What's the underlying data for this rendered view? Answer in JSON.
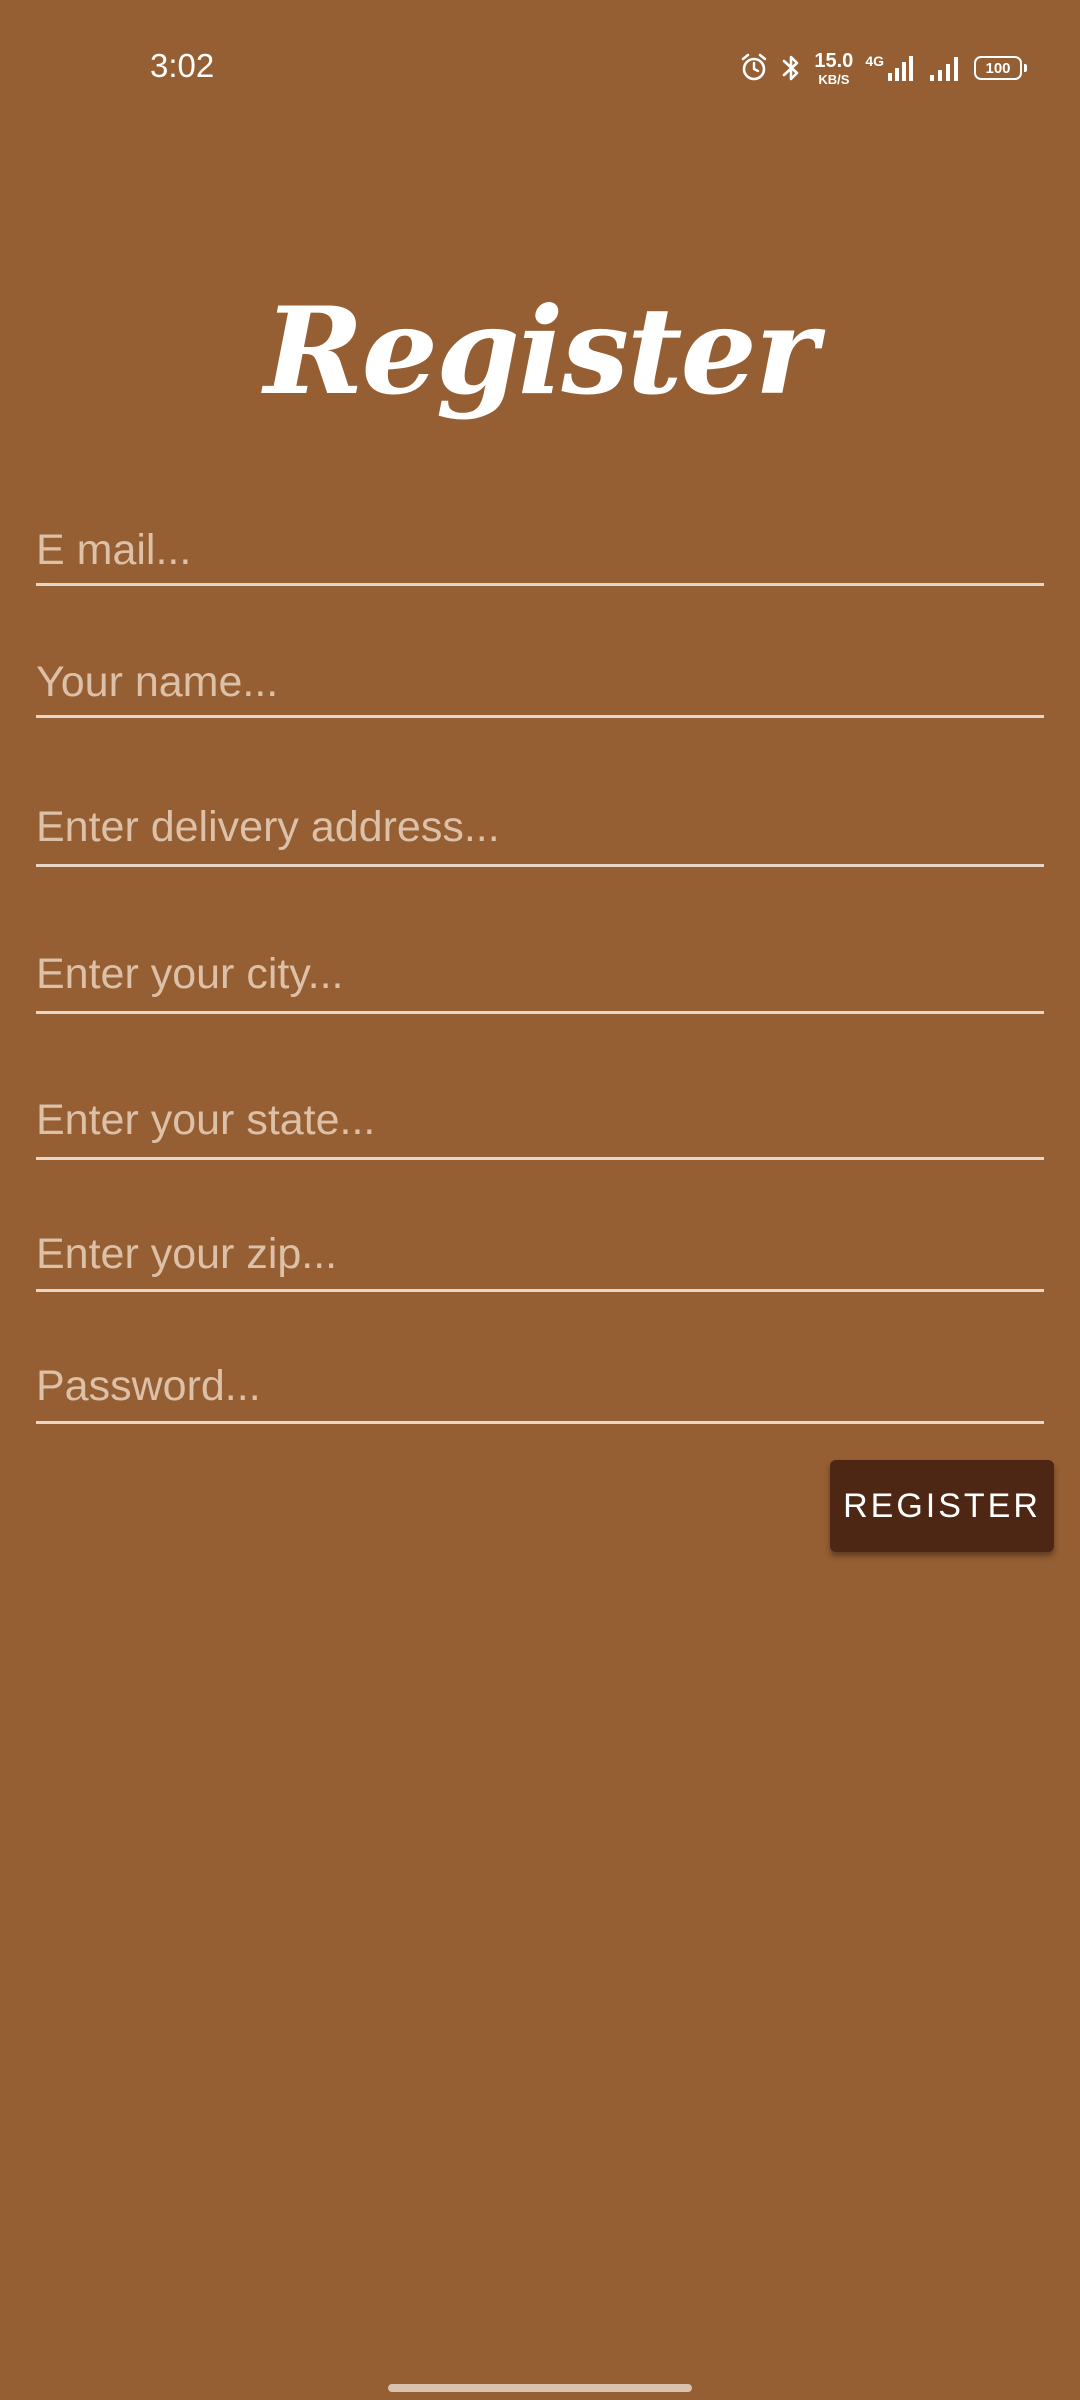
{
  "status_bar": {
    "time": "3:02",
    "net_speed_value": "15.0",
    "net_speed_unit": "KB/S",
    "network_type": "4G",
    "battery_level": "100",
    "icons": [
      "alarm-icon",
      "bluetooth-icon",
      "signal-4g-icon",
      "signal-icon",
      "battery-icon"
    ]
  },
  "page": {
    "title": "Register"
  },
  "form": {
    "email": {
      "placeholder": "E mail...",
      "value": ""
    },
    "name": {
      "placeholder": "Your name...",
      "value": ""
    },
    "address": {
      "placeholder": "Enter delivery address...",
      "value": ""
    },
    "city": {
      "placeholder": "Enter your city...",
      "value": ""
    },
    "state": {
      "placeholder": "Enter your state...",
      "value": ""
    },
    "zip": {
      "placeholder": "Enter your zip...",
      "value": ""
    },
    "password": {
      "placeholder": "Password...",
      "value": ""
    },
    "submit_label": "REGISTER"
  },
  "colors": {
    "background": "#955e33",
    "button": "#4d2714",
    "underline": "#e7d6c8",
    "placeholder": "#dcc0a7"
  }
}
